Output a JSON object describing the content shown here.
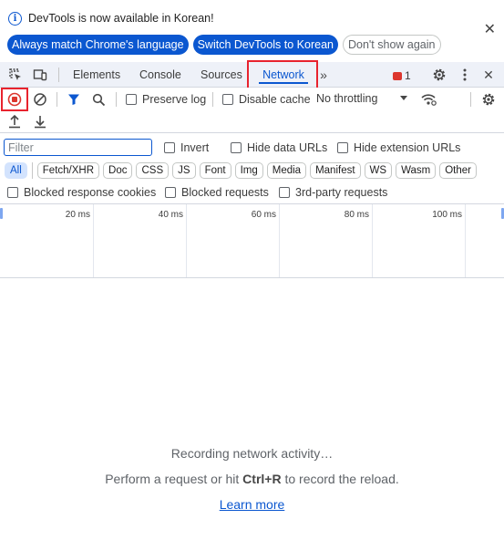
{
  "infobar": {
    "message": "DevTools is now available in Korean!",
    "buttons": {
      "match_language": "Always match Chrome's language",
      "switch_korean": "Switch DevTools to Korean",
      "dont_show": "Don't show again"
    }
  },
  "tabs": {
    "items": [
      "Elements",
      "Console",
      "Sources",
      "Network"
    ],
    "active": "Network",
    "issues_count": "1"
  },
  "toolbar": {
    "preserve_log": "Preserve log",
    "disable_cache": "Disable cache",
    "throttling": "No throttling"
  },
  "filter": {
    "placeholder": "Filter",
    "invert": "Invert",
    "hide_data_urls": "Hide data URLs",
    "hide_extension_urls": "Hide extension URLs",
    "types": [
      "All",
      "Fetch/XHR",
      "Doc",
      "CSS",
      "JS",
      "Font",
      "Img",
      "Media",
      "Manifest",
      "WS",
      "Wasm",
      "Other"
    ],
    "blocked_response_cookies": "Blocked response cookies",
    "blocked_requests": "Blocked requests",
    "third_party_requests": "3rd-party requests"
  },
  "timeline": {
    "ticks": [
      "20 ms",
      "40 ms",
      "60 ms",
      "80 ms",
      "100 ms"
    ]
  },
  "empty_state": {
    "recording": "Recording network activity…",
    "hint_prefix": "Perform a request or hit",
    "shortcut": "Ctrl+R",
    "hint_suffix": "to record the reload.",
    "learn_more": "Learn more"
  },
  "colors": {
    "accent": "#0b57d0",
    "highlight_box": "#e8232e",
    "issue_badge": "#dc362e",
    "record_stop": "#dc362e"
  }
}
